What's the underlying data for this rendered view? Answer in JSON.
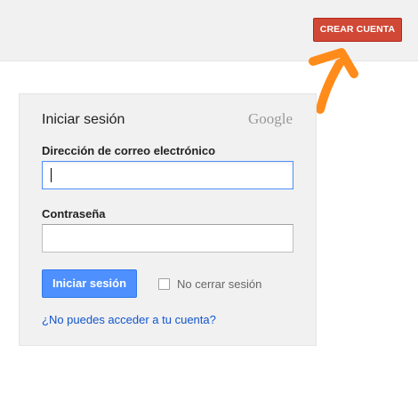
{
  "header": {
    "create_account_label": "CREAR CUENTA",
    "create_account_color": "#d14836"
  },
  "annotation": {
    "arrow_color": "#ff8c1a",
    "arrow_icon": "pointer-arrow-icon"
  },
  "login_card": {
    "title": "Iniciar sesión",
    "logo_text": "Google",
    "email_label": "Dirección de correo electrónico",
    "email_value": "",
    "password_label": "Contraseña",
    "password_value": "",
    "signin_label": "Iniciar sesión",
    "signin_color": "#4d90fe",
    "stay_signed_in_label": "No cerrar sesión",
    "stay_signed_in_checked": false,
    "help_link": "¿No puedes acceder a tu cuenta?"
  }
}
